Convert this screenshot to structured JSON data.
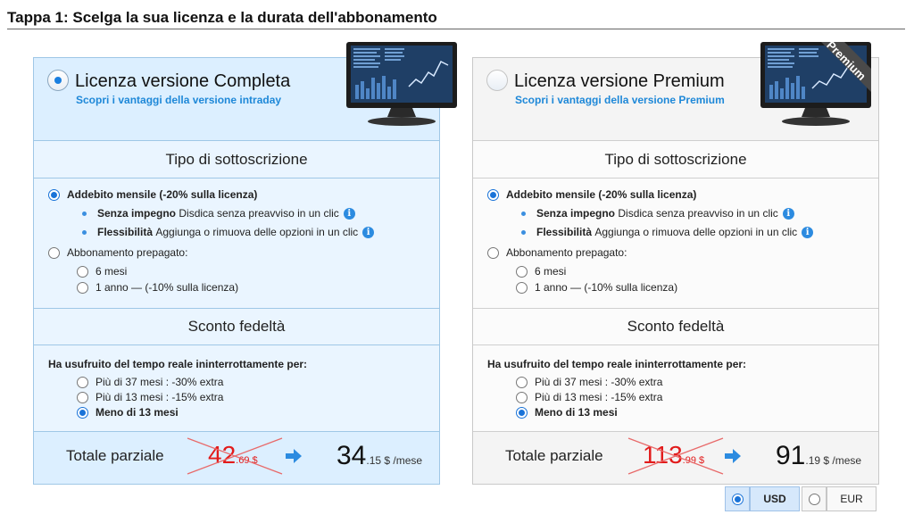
{
  "page": {
    "title": "Tappa 1: Scelga la sua licenza e la durata dell'abbonamento"
  },
  "complete": {
    "title": "Licenza versione Completa",
    "link": "Scopri i vantaggi della versione intraday",
    "subscription_header": "Tipo di sottoscrizione",
    "monthly_label": "Addebito mensile (-20% sulla licenza)",
    "feature1_bold": "Senza impegno",
    "feature1_text": "Disdica senza preavviso in un clic",
    "feature2_bold": "Flessibilità",
    "feature2_text": "Aggiunga o rimuova delle opzioni in un clic",
    "prepaid_label": "Abbonamento prepagato:",
    "prepaid_6": "6 mesi",
    "prepaid_12": "1 anno — (-10% sulla licenza)",
    "loyalty_header": "Sconto fedeltà",
    "loyalty_question": "Ha usufruito del tempo reale ininterrottamente per:",
    "loyalty_37": "Più di 37 mesi : -30% extra",
    "loyalty_13": "Più di 13 mesi : -15% extra",
    "loyalty_less": "Meno di 13 mesi",
    "subtotal_label": "Totale parziale",
    "old_price_int": "42",
    "old_price_dec": ".69 $",
    "new_price_int": "34",
    "new_price_dec": ".15 $ /mese"
  },
  "premium": {
    "title": "Licenza versione Premium",
    "link": "Scopri i vantaggi della versione Premium",
    "ribbon": "Premium",
    "subscription_header": "Tipo di sottoscrizione",
    "monthly_label": "Addebito mensile (-20% sulla licenza)",
    "feature1_bold": "Senza impegno",
    "feature1_text": "Disdica senza preavviso in un clic",
    "feature2_bold": "Flessibilità",
    "feature2_text": "Aggiunga o rimuova delle opzioni in un clic",
    "prepaid_label": "Abbonamento prepagato:",
    "prepaid_6": "6 mesi",
    "prepaid_12": "1 anno — (-10% sulla licenza)",
    "loyalty_header": "Sconto fedeltà",
    "loyalty_question": "Ha usufruito del tempo reale ininterrottamente per:",
    "loyalty_37": "Più di 37 mesi : -30% extra",
    "loyalty_13": "Più di 13 mesi : -15% extra",
    "loyalty_less": "Meno di 13 mesi",
    "subtotal_label": "Totale parziale",
    "old_price_int": "113",
    "old_price_dec": ".99 $",
    "new_price_int": "91",
    "new_price_dec": ".19 $ /mese"
  },
  "currency": {
    "usd": "USD",
    "eur": "EUR",
    "selected": "USD"
  },
  "icons": {
    "info": "i",
    "info_name": "info-icon",
    "arrow_name": "arrow-right-icon",
    "monitor_name": "monitor-chart-icon"
  },
  "colors": {
    "accent": "#1e88d8",
    "old_price": "#e21b1b",
    "complete_bg": "#dcefff",
    "premium_bg": "#f4f4f4"
  }
}
